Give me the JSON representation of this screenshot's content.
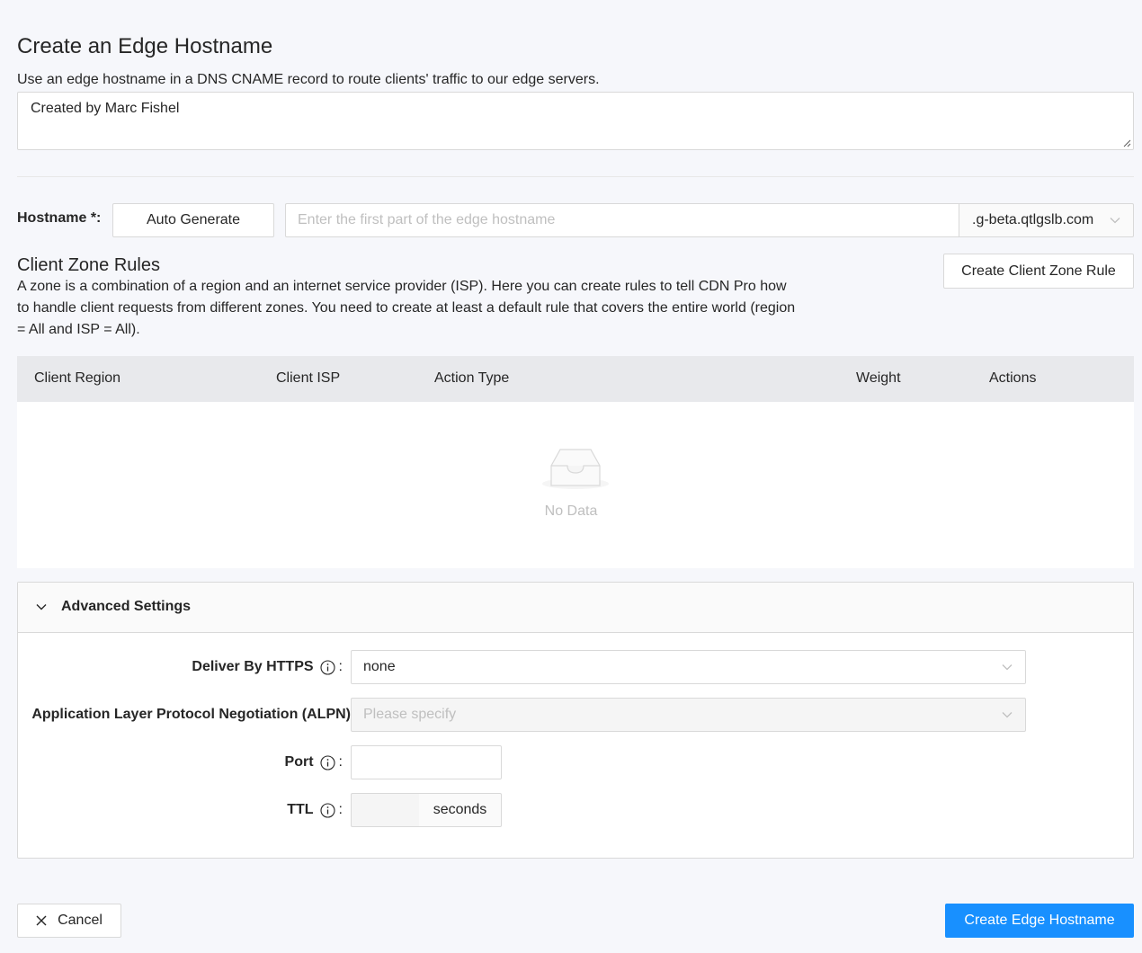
{
  "page": {
    "title": "Create an Edge Hostname",
    "description": "Use an edge hostname in a DNS CNAME record to route clients' traffic to our edge servers.",
    "description_value": "Created by Marc Fishel"
  },
  "hostname": {
    "label": "Hostname",
    "required_mark": "*",
    "colon": ":",
    "auto_generate_label": "Auto Generate",
    "input_placeholder": "Enter the first part of the edge hostname",
    "input_value": "",
    "suffix_value": ".g-beta.qtlgslb.com"
  },
  "client_zone_rules": {
    "title": "Client Zone Rules",
    "description": "A zone is a combination of a region and an internet service provider (ISP). Here you can create rules to tell CDN Pro how to handle client requests from different zones. You need to create at least a default rule that covers the entire world (region = All and ISP = All).",
    "create_button_label": "Create Client Zone Rule",
    "columns": [
      "Client Region",
      "Client ISP",
      "Action Type",
      "Weight",
      "Actions"
    ],
    "rows": [],
    "empty_text": "No Data"
  },
  "advanced_settings": {
    "title": "Advanced Settings",
    "expanded": true,
    "deliver_by_https": {
      "label": "Deliver By HTTPS",
      "value": "none",
      "icon": "info-icon"
    },
    "alpn": {
      "label": "Application Layer Protocol Negotiation (ALPN)",
      "placeholder": "Please specify",
      "disabled": true
    },
    "port": {
      "label": "Port",
      "value": "",
      "icon": "info-icon"
    },
    "ttl": {
      "label": "TTL",
      "value": "",
      "unit": "seconds",
      "icon": "info-icon",
      "disabled": true
    },
    "colon": ":"
  },
  "footer": {
    "cancel_label": "Cancel",
    "submit_label": "Create Edge Hostname"
  },
  "colors": {
    "primary": "#1890ff",
    "background": "#f6f7fb",
    "table_header": "#e8e9ec",
    "border": "#d9d9d9",
    "placeholder": "#bfbfbf"
  }
}
